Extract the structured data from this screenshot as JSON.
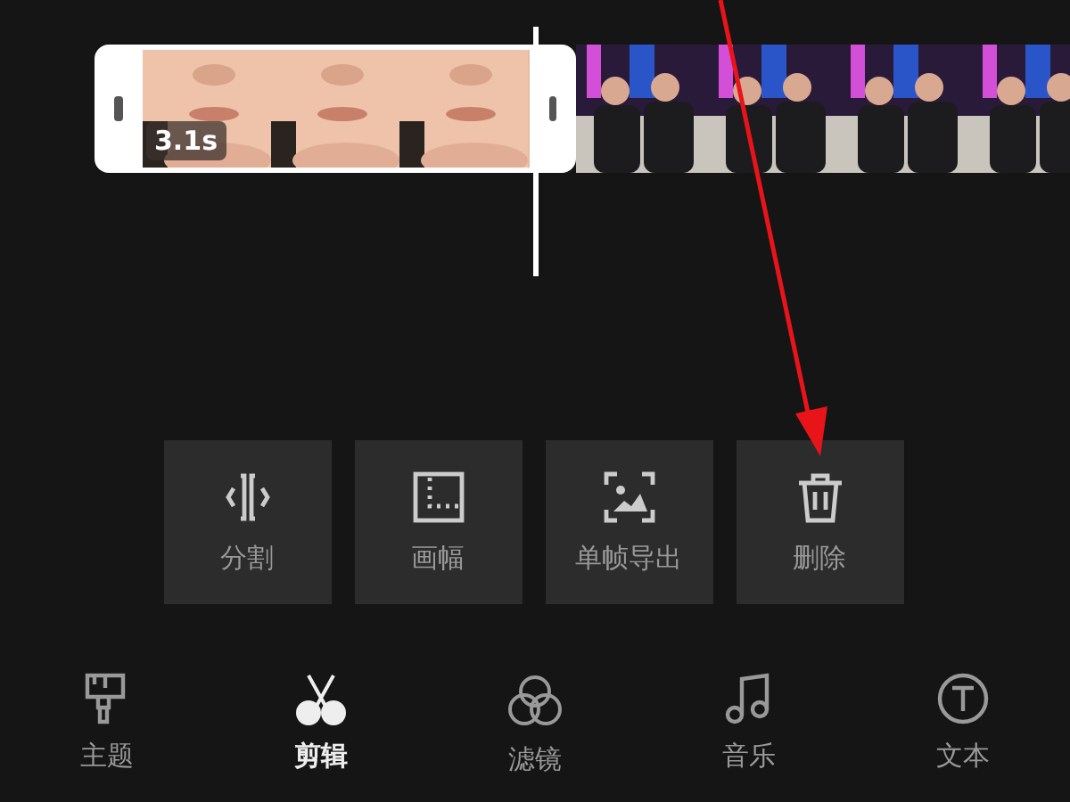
{
  "timeline": {
    "selected_clip": {
      "duration": "3.1s"
    }
  },
  "tools": [
    {
      "label": "分割",
      "kind": "split"
    },
    {
      "label": "画幅",
      "kind": "canvas"
    },
    {
      "label": "单帧导出",
      "kind": "export"
    },
    {
      "label": "删除",
      "kind": "delete"
    }
  ],
  "nav": [
    {
      "label": "主题",
      "kind": "theme",
      "selected": false
    },
    {
      "label": "剪辑",
      "kind": "edit",
      "selected": true
    },
    {
      "label": "滤镜",
      "kind": "filter",
      "selected": false
    },
    {
      "label": "音乐",
      "kind": "music",
      "selected": false
    },
    {
      "label": "文本",
      "kind": "text",
      "selected": false
    }
  ]
}
